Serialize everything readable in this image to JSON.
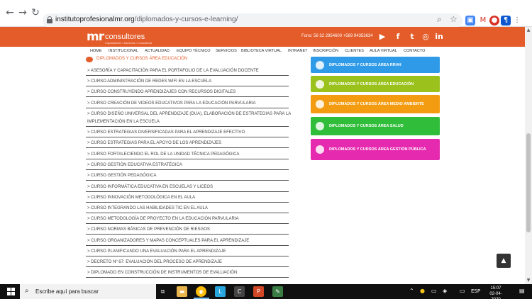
{
  "browser": {
    "url_domain": "institutoprofesionalmr.org",
    "url_path": "/diplomados-y-cursos-e-learning/"
  },
  "header": {
    "logo_mark": "mr",
    "logo_name": "consultores",
    "logo_tagline": "Capacitación • Asesoría • Consultoría",
    "phone": "Fono: 56 32 2954600 +569 94353634",
    "social": [
      "YouTube",
      "Facebook",
      "Twitter",
      "Instagram",
      "LinkedIn"
    ]
  },
  "nav": [
    "HOME",
    "INSTITUCIONAL",
    "ACTUALIDAD",
    "EQUIPO TÉCNICO",
    "SERVICIOS",
    "BIBLIOTECA VIRTUAL",
    "INTRANET",
    "INSCRIPCIÓN",
    "CLIENTES",
    "AULA VIRTUAL",
    "CONTACTO"
  ],
  "content": {
    "section_title": "DIPLOMADOS Y CURSOS ÁREA EDUCACIÓN",
    "courses": [
      "> ASESORÍA Y CAPACITACIÓN PARA EL PORTAFOLIO DE LA EVALUACIÓN DOCENTE",
      "> CURSO ADMINISTRACIÓN DE REDES WIFI EN LA ESCUELA",
      "> CURSO CONSTRUYENDO APRENDIZAJES CON RECURSOS DIGITALES",
      "> CURSO CREACIÓN DE VIDEOS EDUCATIVOS PARA LA EDUCACIÓN PARVULARIA",
      "> CURSO DISEÑO UNIVERSAL DEL APRENDIZAJE (DUA), ELABORACIÓN DE ESTRATEGIAS PARA LA",
      "IMPLEMENTACIÓN EN LA ESCUELA",
      "> CURSO ESTRATEGIAS DIVERSIFICADAS PARA EL APRENDIZAJE EFECTIVO",
      "> CURSO ESTRATEGIAS PARA EL APOYO DE LOS APRENDIZAJES",
      "> CURSO FORTALECIENDO EL ROL DE LA UNIDAD TÉCNICA PEDAGÓGICA",
      "> CURSO GESTIÓN EDUCATIVA ESTRATÉGICA",
      "> CURSO GESTIÓN PEDAGÓGICA",
      "> CURSO INFORMÁTICA EDUCATIVA EN ESCUELAS Y LICEOS",
      "> CURSO INNOVACIÓN METODOLÓGICA EN EL AULA",
      "> CURSO INTEGRANDO LAS HABILIDADES TIC EN EL AULA",
      "> CURSO METODOLOGÍA DE PROYECTO EN LA EDUCACIÓN PARVULARIA",
      "> CURSO NORMAS BÁSICAS DE PREVENCIÓN DE RIESGOS",
      "> CURSO ORGANIZADORES Y MAPAS CONCEPTUALES PARA EL APRENDIZAJE",
      "> CURSO PLANIFICANDO UNA EVALUACIÓN PARA EL APRENDIZAJE",
      "> DECRETO Nº 67: EVALUACIÓN DEL PROCESO DE APRENDIZAJE",
      "> DIPLOMADO EN CONSTRUCCIÓN DE INSTRUMENTOS DE EVALUACIÓN"
    ]
  },
  "blocks": [
    {
      "label": "DIPLOMADOS Y CURSOS ÁREA RRHH",
      "color": "#2f9be8"
    },
    {
      "label": "DIPLOMADOS Y CURSOS ÁREA EDUCACIÓN",
      "color": "#9bc21c"
    },
    {
      "label": "DIPLOMADOS Y CURSOS ÁREA MEDIO AMBIENTE",
      "color": "#f39c12"
    },
    {
      "label": "DIPLOMADOS Y CURSOS ÁREA SALUD",
      "color": "#2fbd3a"
    },
    {
      "label": "DIPLOMADOS Y CURSOS ÁREA GESTIÓN PÚBLICA",
      "color": "#e62ab0"
    }
  ],
  "taskbar": {
    "search_placeholder": "Escribe aquí para buscar",
    "lang": "ESP",
    "time": "15:07",
    "date": "02-04-2020"
  }
}
